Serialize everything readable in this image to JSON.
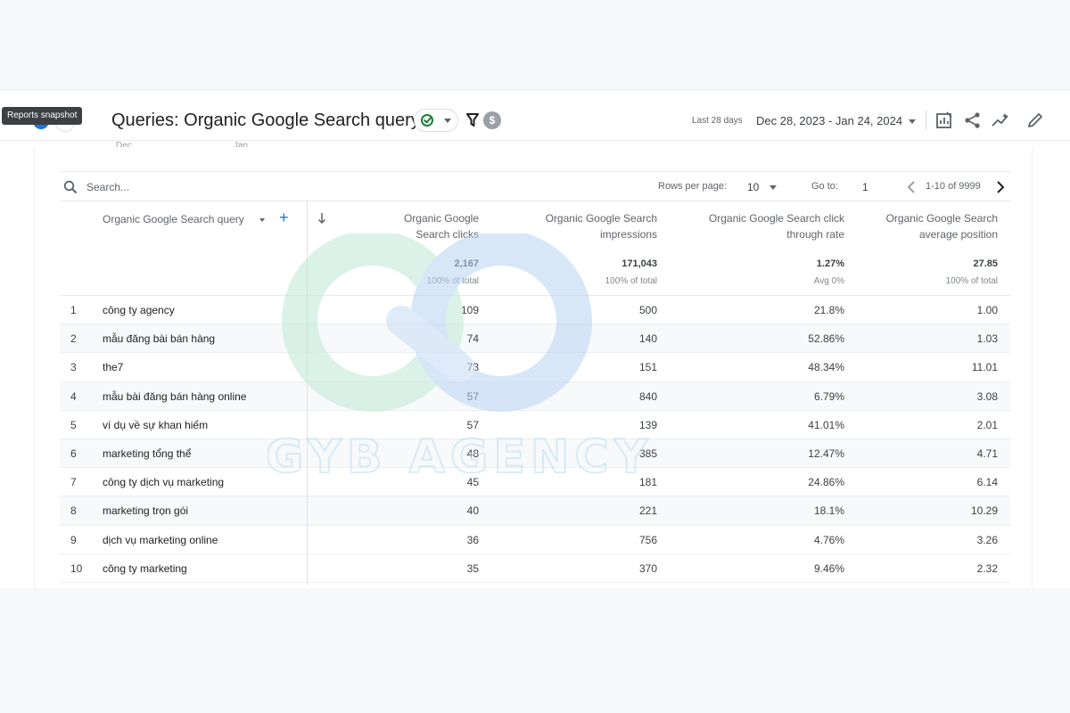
{
  "tooltip": "Reports snapshot",
  "header": {
    "title": "Queries: Organic Google Search query",
    "compare_badge": "$",
    "date_label": "Last 28 days",
    "date_range": "Dec 28, 2023 - Jan 24, 2024"
  },
  "chart_axis_ghost": [
    "Dec",
    "Jan"
  ],
  "toolbar": {
    "search_placeholder": "Search...",
    "rows_per_page_label": "Rows per page:",
    "rows_per_page_value": "10",
    "goto_label": "Go to:",
    "goto_value": "1",
    "pagination": "1-10 of 9999"
  },
  "table": {
    "dimension_header": "Organic Google Search query",
    "columns": [
      {
        "label_1": "Organic Google",
        "label_2": "Search clicks",
        "total": "2,167",
        "sub": "100% of total"
      },
      {
        "label_1": "Organic Google Search",
        "label_2": "impressions",
        "total": "171,043",
        "sub": "100% of total"
      },
      {
        "label_1": "Organic Google Search click",
        "label_2": "through rate",
        "total": "1.27%",
        "sub": "Avg 0%"
      },
      {
        "label_1": "Organic Google Search",
        "label_2": "average position",
        "total": "27.85",
        "sub": "100% of total"
      }
    ],
    "rows": [
      {
        "idx": "1",
        "query": "công ty agency",
        "clicks": "109",
        "impressions": "500",
        "ctr": "21.8%",
        "position": "1.00"
      },
      {
        "idx": "2",
        "query": "mẫu đăng bài bán hàng",
        "clicks": "74",
        "impressions": "140",
        "ctr": "52.86%",
        "position": "1.03"
      },
      {
        "idx": "3",
        "query": "the7",
        "clicks": "73",
        "impressions": "151",
        "ctr": "48.34%",
        "position": "11.01"
      },
      {
        "idx": "4",
        "query": "mẫu bài đăng bán hàng online",
        "clicks": "57",
        "impressions": "840",
        "ctr": "6.79%",
        "position": "3.08"
      },
      {
        "idx": "5",
        "query": "ví dụ về sự khan hiếm",
        "clicks": "57",
        "impressions": "139",
        "ctr": "41.01%",
        "position": "2.01"
      },
      {
        "idx": "6",
        "query": "marketing tổng thể",
        "clicks": "48",
        "impressions": "385",
        "ctr": "12.47%",
        "position": "4.71"
      },
      {
        "idx": "7",
        "query": "công ty dịch vụ marketing",
        "clicks": "45",
        "impressions": "181",
        "ctr": "24.86%",
        "position": "6.14"
      },
      {
        "idx": "8",
        "query": "marketing trọn gói",
        "clicks": "40",
        "impressions": "221",
        "ctr": "18.1%",
        "position": "10.29"
      },
      {
        "idx": "9",
        "query": "dịch vụ marketing online",
        "clicks": "36",
        "impressions": "756",
        "ctr": "4.76%",
        "position": "3.26"
      },
      {
        "idx": "10",
        "query": "công ty marketing",
        "clicks": "35",
        "impressions": "370",
        "ctr": "9.46%",
        "position": "2.32"
      }
    ]
  },
  "watermark": {
    "text": "GYB AGENCY"
  },
  "colors": {
    "accent": "#1a73e8",
    "ok": "#188038",
    "text": "#3c4043"
  }
}
